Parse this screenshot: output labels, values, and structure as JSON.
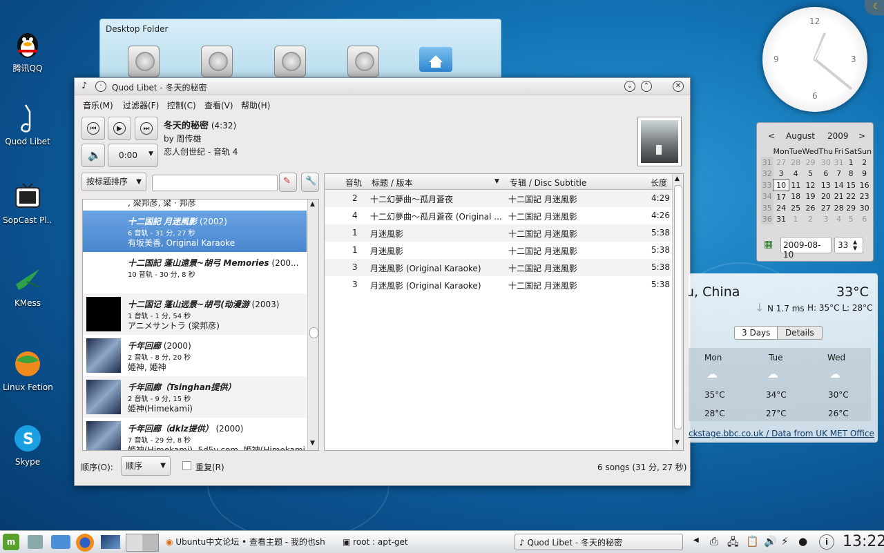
{
  "desktop": {
    "icons": [
      {
        "label": "腾讯QQ"
      },
      {
        "label": "Quod Libet"
      },
      {
        "label": "SopCast Pl..."
      },
      {
        "label": "KMess"
      },
      {
        "label": "Linux Fetion"
      },
      {
        "label": "Skype"
      }
    ],
    "folder_title": "Desktop Folder"
  },
  "window": {
    "title": "Quod Libet - 冬天的秘密",
    "menu": [
      "音乐(M)",
      "过滤器(F)",
      "控制(C)",
      "查看(V)",
      "帮助(H)"
    ],
    "time_display": "0:00",
    "now_playing": {
      "title": "冬天的秘密",
      "duration": "(4:32)",
      "artist_line": "by 周传雄",
      "album_line": "恋人创世纪 - 音轨 4"
    },
    "sort_combo": "按标题排序",
    "search_value": "",
    "albums": [
      {
        "partial": ", 梁邦彦, 梁 · 邦彦"
      },
      {
        "title": "十二国記 月迷風影",
        "year": "(2002)",
        "meta": "6 音轨 - 31 分, 27 秒",
        "artists": "有坂美香, Original Karaoke",
        "selected": true
      },
      {
        "title": "十二国記 蓬山遠景~胡弓 Memories",
        "year": "(200...",
        "meta": "10 音轨 - 30 分, 8 秒",
        "artists": ""
      },
      {
        "title": "十二国记 蓬山远景~胡弓(动漫游",
        "year": "(2003)",
        "meta": "1 音轨 - 1 分, 54 秒",
        "artists": "アニメサントラ (梁邦彦)"
      },
      {
        "title": "千年回廊",
        "year": "(2000)",
        "meta": "2 音轨 - 8 分, 20 秒",
        "artists": "姫神, 姫神"
      },
      {
        "title": "千年回廊（Tsinghan提供）",
        "year": "",
        "meta": "2 音轨 - 9 分, 15 秒",
        "artists": "姫神(Himekami)"
      },
      {
        "title": "千年回廊（dklz提供）",
        "year": "(2000)",
        "meta": "7 音轨 - 29 分, 8 秒",
        "artists": "姫神(Himekami), 5d5v.com, 姫神(Himekami..."
      }
    ],
    "columns": {
      "track": "音轨",
      "title": "标题 / 版本",
      "album": "专辑 / Disc Subtitle",
      "length": "长度"
    },
    "tracks": [
      {
        "track": "2",
        "title": "十二幻夢曲～孤月蒼夜",
        "album": "十二国記 月迷風影",
        "length": "4:29"
      },
      {
        "track": "4",
        "title": "十二幻夢曲～孤月蒼夜 (Original ...",
        "album": "十二国記 月迷風影",
        "length": "4:26"
      },
      {
        "track": "1",
        "title": "月迷風影",
        "album": "十二国記 月迷風影",
        "length": "5:38"
      },
      {
        "track": "1",
        "title": "月迷風影",
        "album": "十二国記 月迷風影",
        "length": "5:38"
      },
      {
        "track": "3",
        "title": "月迷風影 (Original Karaoke)",
        "album": "十二国記 月迷風影",
        "length": "5:38"
      },
      {
        "track": "3",
        "title": "月迷風影 (Original Karaoke)",
        "album": "十二国記 月迷風影",
        "length": "5:38"
      }
    ],
    "order_label": "顺序(O):",
    "order_value": "顺序",
    "repeat_label": "重复(R)",
    "status": "6 songs (31 分, 27 秒)"
  },
  "clock": {
    "n12": "12",
    "n3": "3",
    "n6": "6",
    "n9": "9"
  },
  "calendar": {
    "month": "August",
    "year": "2009",
    "weekdays": [
      "Mon",
      "Tue",
      "Wed",
      "Thu",
      "Fri",
      "Sat",
      "Sun"
    ],
    "weeks": [
      {
        "wk": "31",
        "days": [
          "27",
          "28",
          "29",
          "30",
          "31",
          "1",
          "2"
        ]
      },
      {
        "wk": "32",
        "days": [
          "3",
          "4",
          "5",
          "6",
          "7",
          "8",
          "9"
        ]
      },
      {
        "wk": "33",
        "days": [
          "10",
          "11",
          "12",
          "13",
          "14",
          "15",
          "16"
        ]
      },
      {
        "wk": "34",
        "days": [
          "17",
          "18",
          "19",
          "20",
          "21",
          "22",
          "23"
        ]
      },
      {
        "wk": "35",
        "days": [
          "24",
          "25",
          "26",
          "27",
          "28",
          "29",
          "30"
        ]
      },
      {
        "wk": "36",
        "days": [
          "31",
          "1",
          "2",
          "3",
          "4",
          "5",
          "6"
        ]
      }
    ],
    "date_field": "2009-08-10",
    "week_field": "33"
  },
  "weather": {
    "location": "u, China",
    "temp": "33°C",
    "wind": "N 1.7 ms",
    "hilo": "H: 35°C  L: 28°C",
    "tab_days": "3 Days",
    "tab_details": "Details",
    "days": [
      {
        "name": "Mon",
        "high": "35°C",
        "low": "28°C"
      },
      {
        "name": "Tue",
        "high": "34°C",
        "low": "27°C"
      },
      {
        "name": "Wed",
        "high": "30°C",
        "low": "26°C"
      }
    ],
    "source": "ckstage.bbc.co.uk / Data from UK MET Office"
  },
  "taskbar": {
    "tasks": [
      "Ubuntu中文论坛 • 查看主题 - 我的也sh",
      "root : apt-get",
      "Quod Libet - 冬天的秘密"
    ],
    "time": "13:22"
  }
}
